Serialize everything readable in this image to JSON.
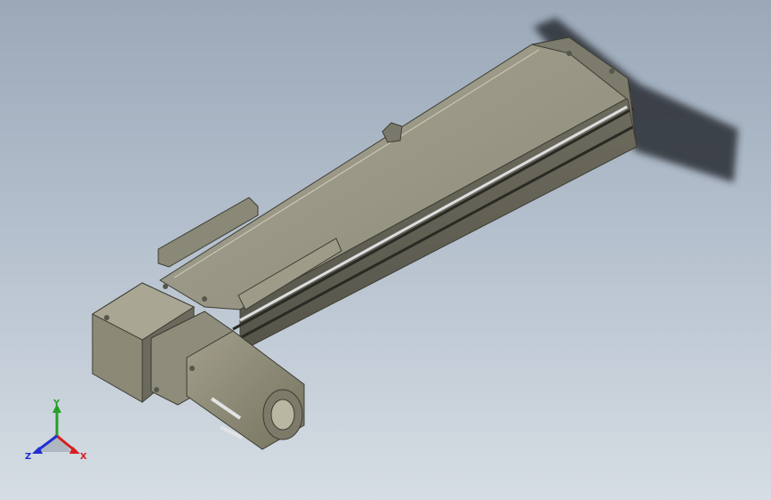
{
  "viewport": {
    "background_top": "#9aa8b8",
    "background_bottom": "#d6dde4"
  },
  "model": {
    "part_color": "#8f8d7b",
    "part_dark": "#5e5c4f",
    "part_light": "#b4b19e",
    "shaft_color": "#d9dbdd"
  },
  "triad": {
    "x_label": "X",
    "y_label": "Y",
    "z_label": "Z",
    "x_color": "#d42020",
    "y_color": "#25a025",
    "z_color": "#2030d0"
  }
}
